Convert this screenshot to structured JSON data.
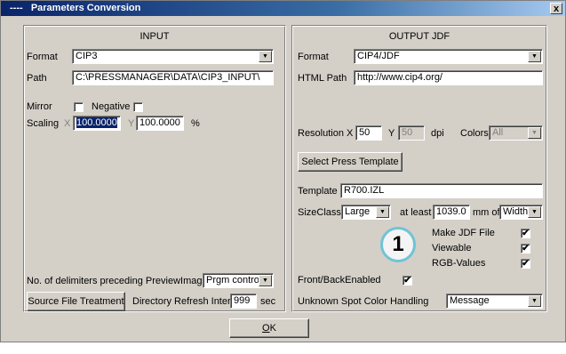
{
  "titlebar": {
    "title": "----   Parameters Conversion",
    "close": "x"
  },
  "input": {
    "heading": "INPUT",
    "format_label": "Format",
    "format_value": "CIP3",
    "path_label": "Path",
    "path_value": "C:\\PRESSMANAGER\\DATA\\CIP3_INPUT\\",
    "mirror_label": "Mirror",
    "negative_label": "Negative",
    "scaling_label": "Scaling",
    "x_label": "X",
    "x_value": "100.0000",
    "y_label": "Y",
    "y_value": "100.0000",
    "unit": "%",
    "delimiters_label": "No. of delimiters preceding PreviewImage",
    "delimiters_value": "Prgm control",
    "source_button": "Source File Treatment",
    "refresh_label": "Directory Refresh Interv.",
    "refresh_value": "999",
    "refresh_unit": "sec"
  },
  "output": {
    "heading": "OUTPUT JDF",
    "format_label": "Format",
    "format_value": "CIP4/JDF",
    "htmlpath_label": "HTML Path",
    "htmlpath_value": "http://www.cip4.org/",
    "resolution_label": "Resolution",
    "x_label": "X",
    "res_x": "50",
    "y_label": "Y",
    "res_y": "50",
    "dpi": "dpi",
    "colors_label": "Colors",
    "colors_value": "All",
    "select_template_button": "Select Press Template",
    "template_label": "Template",
    "template_value": "R700.IZL",
    "sizeclass_label": "SizeClass",
    "sizeclass_value": "Large",
    "atleast_label": "at least",
    "atleast_value": "1039.0",
    "mm_of": "mm of",
    "width_value": "Width",
    "make_jdf_label": "Make JDF File",
    "make_jdf_checked": true,
    "viewable_label": "Viewable",
    "viewable_checked": true,
    "rgb_label": "RGB-Values",
    "rgb_checked": true,
    "frontback_label": "Front/BackEnabled",
    "frontback_checked": true,
    "unknown_spot_label": "Unknown Spot Color Handling",
    "unknown_spot_value": "Message"
  },
  "callout_number": "1",
  "ok_button": {
    "underlined": "O",
    "rest": "K"
  },
  "check_mark": "✔",
  "dropdown_arrow": "▼"
}
